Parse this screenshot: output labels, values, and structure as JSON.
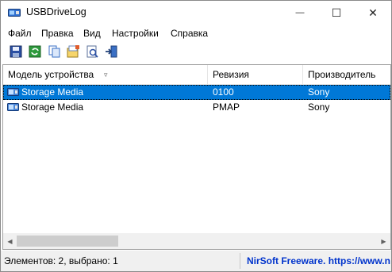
{
  "window": {
    "title": "USBDriveLog"
  },
  "title_buttons": {
    "minimize": "—",
    "maximize": "☐",
    "close": "✕"
  },
  "menu": {
    "items": [
      {
        "label": "Файл"
      },
      {
        "label": "Правка"
      },
      {
        "label": "Вид"
      },
      {
        "label": "Настройки"
      },
      {
        "label": "Справка"
      }
    ]
  },
  "toolbar": {
    "buttons": [
      {
        "icon": "save-icon"
      },
      {
        "icon": "refresh-icon"
      },
      {
        "icon": "copy-icon"
      },
      {
        "icon": "html-report-icon"
      },
      {
        "icon": "properties-icon"
      },
      {
        "icon": "exit-icon"
      }
    ]
  },
  "table": {
    "columns": [
      {
        "label": "Модель устройства",
        "sort": "▿"
      },
      {
        "label": "Ревизия"
      },
      {
        "label": "Производитель"
      }
    ],
    "rows": [
      {
        "model": "Storage Media",
        "revision": "0100",
        "vendor": "Sony",
        "selected": true
      },
      {
        "model": "Storage Media",
        "revision": "PMAP",
        "vendor": "Sony",
        "selected": false
      }
    ]
  },
  "scroll": {
    "left_arrow": "◀",
    "right_arrow": "▶"
  },
  "status": {
    "items_text": "Элементов: 2, выбрано: 1",
    "link_text": "NirSoft Freeware. https://www.n"
  },
  "colors": {
    "selection": "#0078d7",
    "link": "#0033cc"
  }
}
